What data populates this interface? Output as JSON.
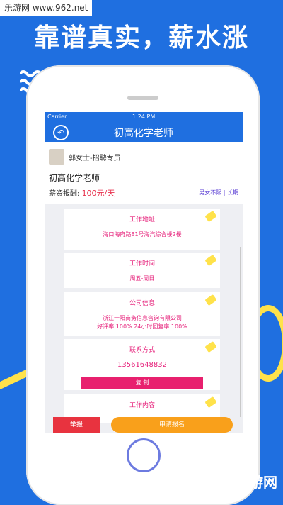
{
  "watermark_top": "乐游网 www.962.net",
  "headline": "靠谱真实，薪水涨",
  "status_bar": {
    "carrier": "Carrier",
    "time": "1:24 PM"
  },
  "nav": {
    "title": "初高化学老师"
  },
  "poster": {
    "name": "郭女士-招聘专员"
  },
  "job": {
    "title": "初高化学老师",
    "salary_label": "薪资报酬:",
    "salary_value": "100元/天",
    "tags": "男女不限 | 长期"
  },
  "cards": [
    {
      "title": "工作地址",
      "text": "海口海府路81号海汽综合楼2楼"
    },
    {
      "title": "工作时间",
      "text": "周五-周日"
    },
    {
      "title": "公司信息",
      "text": "浙江一阳商务信息咨询有限公司",
      "text2": "好评率 100% 24小时回复率 100%"
    },
    {
      "title": "联系方式",
      "text": "13561648832",
      "button": "复 制"
    },
    {
      "title": "工作内容"
    }
  ],
  "bottom": {
    "report": "举报",
    "apply": "申请报名"
  },
  "watermark_bottom": "962.NET 乐游网",
  "colors": {
    "brand_blue": "#1f6fe0",
    "pink": "#e6207a",
    "orange": "#f9a01b",
    "red": "#e8333f",
    "yellow": "#ffe24a"
  }
}
